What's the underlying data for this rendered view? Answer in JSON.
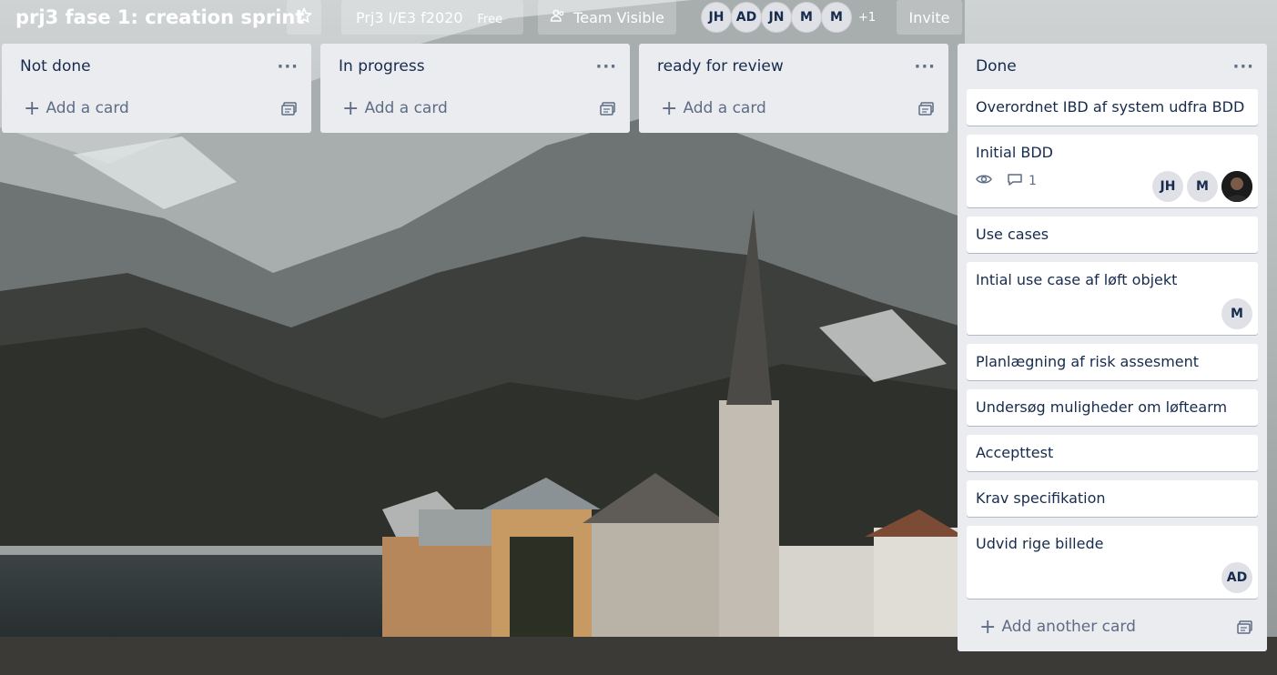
{
  "header": {
    "board_title": "prj3 fase 1: creation sprint",
    "team_name": "Prj3 I/E3 f2020",
    "plan": "Free",
    "visibility": "Team Visible",
    "members": [
      "JH",
      "AD",
      "JN",
      "M",
      "M"
    ],
    "more_members": "+1",
    "invite_label": "Invite"
  },
  "lists": [
    {
      "title": "Not done",
      "add_card": "Add a card"
    },
    {
      "title": "In progress",
      "add_card": "Add a card"
    },
    {
      "title": "ready for review",
      "add_card": "Add a card"
    },
    {
      "title": "Done",
      "add_card": "Add another card",
      "cards": [
        {
          "title": "Overordnet IBD af system udfra BDD"
        },
        {
          "title": "Initial BDD",
          "comments": "1",
          "members": [
            "JH",
            "M"
          ]
        },
        {
          "title": "Use cases"
        },
        {
          "title": "Intial use case af løft objekt",
          "members": [
            "M"
          ]
        },
        {
          "title": "Planlægning af risk assesment"
        },
        {
          "title": "Undersøg muligheder om løftearm"
        },
        {
          "title": "Accepttest"
        },
        {
          "title": "Krav specifikation"
        },
        {
          "title": "Udvid rige billede",
          "members": [
            "AD"
          ]
        }
      ]
    }
  ],
  "menu_glyph": "···",
  "plus_glyph": "+",
  "colors": {
    "list_bg": "#ebecf0",
    "card_bg": "#ffffff",
    "text": "#172b4d",
    "muted": "#5e6c84"
  }
}
